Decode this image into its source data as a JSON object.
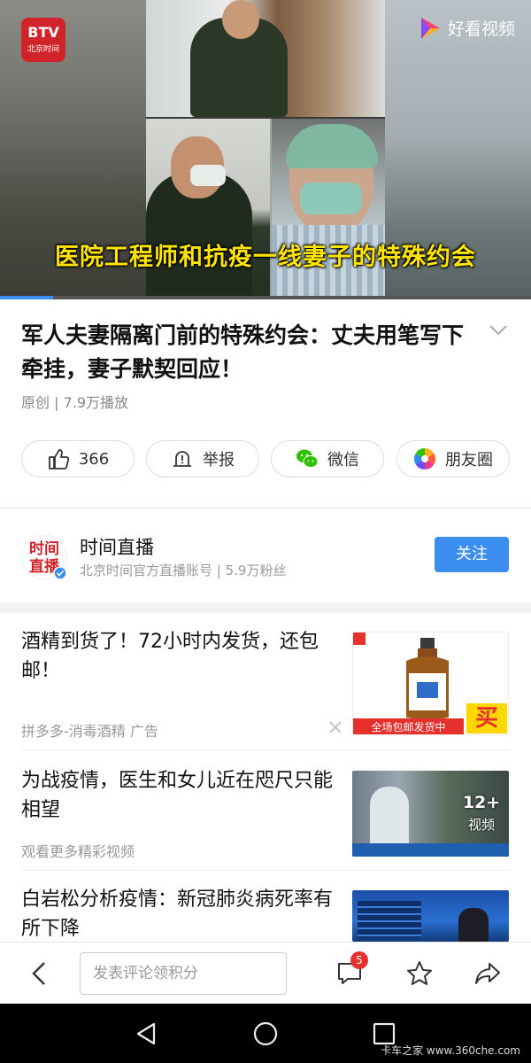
{
  "video": {
    "caption": "医院工程师和抗疫一线妻子的特殊约会",
    "channel_logo_text": "BTV",
    "channel_logo_sub": "北京时间",
    "brand": "好看视频",
    "progress_fraction": 0.1
  },
  "article": {
    "title": "军人夫妻隔离门前的特殊约会：丈夫用笔写下牵挂，妻子默契回应！",
    "meta": "原创 | 7.9万播放"
  },
  "actions": [
    {
      "label": "366",
      "icon": "thumbs-up-icon"
    },
    {
      "label": "举报",
      "icon": "report-icon"
    },
    {
      "label": "微信",
      "icon": "wechat-icon"
    },
    {
      "label": "朋友圈",
      "icon": "moments-icon"
    }
  ],
  "account": {
    "name": "时间直播",
    "avatar_text": "时间直播",
    "description": "北京时间官方直播账号 | 5.9万粉丝",
    "follow_label": "关注"
  },
  "feed": [
    {
      "title": "酒精到货了！72小时内发货，还包邮！",
      "sub": "拼多多-消毒酒精  广告",
      "thumb_banner": "全场包邮发货中",
      "thumb_buy": "买"
    },
    {
      "title": "为战疫情，医生和女儿近在咫尺只能相望",
      "sub": "观看更多精彩视频",
      "thumb_count": "12+",
      "thumb_label": "视频"
    },
    {
      "title": "白岩松分析疫情：新冠肺炎病死率有所下降"
    }
  ],
  "bottombar": {
    "comment_placeholder": "发表评论领积分",
    "comment_badge": "5"
  },
  "watermark": "卡车之家 www.360che.com",
  "colors": {
    "accent": "#3b8ef0",
    "caption_yellow": "#ffe400",
    "btv_red": "#d0232a",
    "badge_red": "#e6302d"
  }
}
